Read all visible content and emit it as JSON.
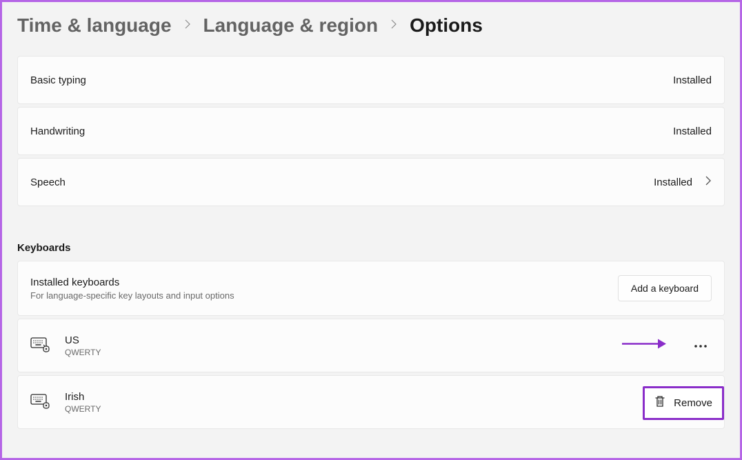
{
  "breadcrumb": {
    "level1": "Time & language",
    "level2": "Language & region",
    "current": "Options"
  },
  "features": [
    {
      "name": "Basic typing",
      "status": "Installed",
      "hasChevron": false
    },
    {
      "name": "Handwriting",
      "status": "Installed",
      "hasChevron": false
    },
    {
      "name": "Speech",
      "status": "Installed",
      "hasChevron": true
    }
  ],
  "keyboardsSection": {
    "header": "Keyboards",
    "installedTitle": "Installed keyboards",
    "installedSub": "For language-specific key layouts and input options",
    "addButton": "Add a keyboard"
  },
  "keyboards": [
    {
      "name": "US",
      "layout": "QWERTY"
    },
    {
      "name": "Irish",
      "layout": "QWERTY"
    }
  ],
  "contextMenu": {
    "remove": "Remove"
  }
}
